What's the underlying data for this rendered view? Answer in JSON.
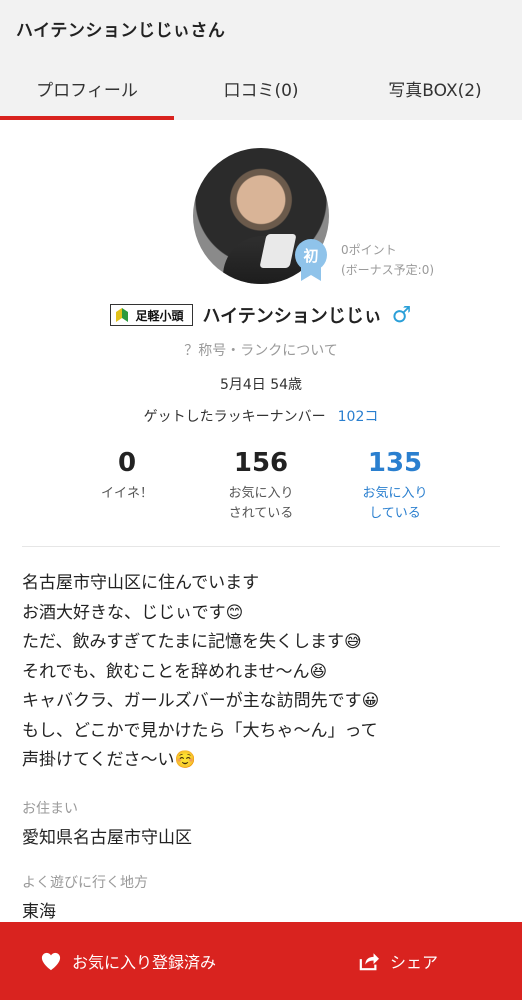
{
  "header": {
    "title": "ハイテンションじじぃさん"
  },
  "tabs": [
    {
      "label": "プロフィール",
      "active": true
    },
    {
      "label": "口コミ(0)",
      "active": false
    },
    {
      "label": "写真BOX(2)",
      "active": false
    }
  ],
  "profile": {
    "badge_text": "初",
    "points": "0ポイント",
    "bonus": "(ボーナス予定:0)",
    "rank_label": "足軽小頭",
    "name": "ハイテンションじじぃ",
    "gender_symbol": "♂",
    "rank_link": "？称号・ランクについて",
    "birthday_age": "5月4日 54歳",
    "lucky_label": "ゲットしたラッキーナンバー",
    "lucky_value": "102コ"
  },
  "stats": [
    {
      "num": "0",
      "label_1": "イイネ！",
      "label_2": ""
    },
    {
      "num": "156",
      "label_1": "お気に入り",
      "label_2": "されている"
    },
    {
      "num": "135",
      "label_1": "お気に入り",
      "label_2": "している"
    }
  ],
  "bio": [
    "名古屋市守山区に住んでいます",
    "お酒大好きな、じじぃです😊",
    "ただ、飲みすぎてたまに記憶を失くします😅",
    "それでも、飲むことを辞めれませ〜ん😆",
    "キャバクラ、ガールズバーが主な訪問先です😀",
    "もし、どこかで見かけたら「大ちゃ〜ん」って",
    "声掛けてくださ〜い☺️"
  ],
  "fields": {
    "residence_label": "お住まい",
    "residence_value": "愛知県名古屋市守山区",
    "area_label": "よく遊びに行く地方",
    "area_value": "東海"
  },
  "bottom_bar": {
    "favorite_label": "お気に入り登録済み",
    "share_label": "シェア"
  },
  "colors": {
    "accent": "#d9231f",
    "link": "#2a7fcf",
    "gender": "#2a9fd8"
  }
}
